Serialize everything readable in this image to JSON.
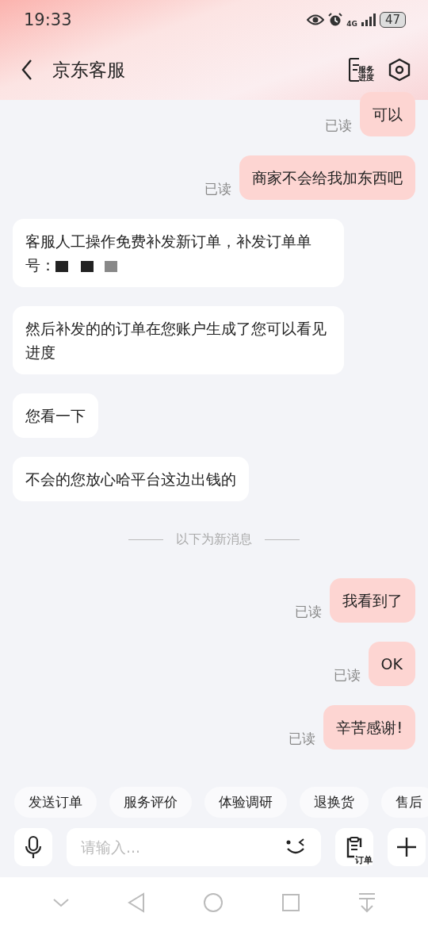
{
  "status_bar": {
    "time": "19:33",
    "network": "4G",
    "battery": "47"
  },
  "header": {
    "title": "京东客服",
    "progress_label_1": "服务",
    "progress_label_2": "进度"
  },
  "messages": [
    {
      "kind": "out",
      "text": "可以",
      "status": "已读"
    },
    {
      "kind": "out",
      "text": "商家不会给我加东西吧",
      "status": "已读"
    },
    {
      "kind": "in",
      "text": "客服人工操作免费补发新订单，补发订单单号：",
      "redacted": true
    },
    {
      "kind": "in",
      "text": "然后补发的的订单在您账户生成了您可以看见进度"
    },
    {
      "kind": "in",
      "text": "您看一下"
    },
    {
      "kind": "in",
      "text": "不会的您放心哈平台这边出钱的"
    },
    {
      "kind": "divider",
      "text": "以下为新消息"
    },
    {
      "kind": "out",
      "text": "我看到了",
      "status": "已读"
    },
    {
      "kind": "out",
      "text": "OK",
      "status": "已读"
    },
    {
      "kind": "out",
      "text": "辛苦感谢!",
      "status": "已读"
    }
  ],
  "quick_replies": [
    "发送订单",
    "服务评价",
    "体验调研",
    "退换货",
    "售后"
  ],
  "input": {
    "placeholder": "请输入...",
    "order_label": "订单"
  }
}
